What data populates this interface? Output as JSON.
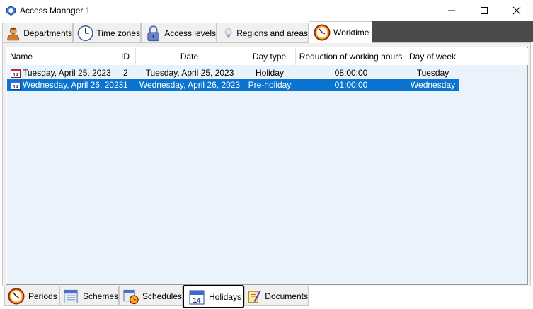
{
  "window": {
    "title": "Access Manager 1"
  },
  "top_tabs": [
    {
      "label": "Departments",
      "icon": "person-icon"
    },
    {
      "label": "Time zones",
      "icon": "clock-icon"
    },
    {
      "label": "Access levels",
      "icon": "lock-icon"
    },
    {
      "label": "Regions and areas",
      "icon": "lightbulb-icon"
    },
    {
      "label": "Worktime",
      "icon": "worktime-clock-icon",
      "active": true
    }
  ],
  "table": {
    "columns": [
      "Name",
      "ID",
      "Date",
      "Day type",
      "Reduction of working hours",
      "Day of week"
    ],
    "rows": [
      {
        "name": "Tuesday, April 25, 2023",
        "id": "2",
        "date": "Tuesday, April 25, 2023",
        "day_type": "Holiday",
        "reduction": "08:00:00",
        "day_of_week": "Tuesday",
        "selected": false
      },
      {
        "name": "Wednesday, April 26, 2023",
        "id": "1",
        "date": "Wednesday, April 26, 2023",
        "day_type": "Pre-holiday",
        "reduction": "01:00:00",
        "day_of_week": "Wednesday",
        "selected": true
      }
    ]
  },
  "bottom_tabs": [
    {
      "label": "Periods",
      "icon": "periods-clock-icon"
    },
    {
      "label": "Schemes",
      "icon": "schemes-calendar-icon"
    },
    {
      "label": "Schedules",
      "icon": "schedules-calendar-icon"
    },
    {
      "label": "Holidays",
      "icon": "holidays-calendar-icon",
      "active": true
    },
    {
      "label": "Documents",
      "icon": "documents-icon"
    }
  ],
  "colors": {
    "selection": "#0a74d0",
    "list_background": "#eaf3fc",
    "tab_strip_dark": "#4b4b4b"
  }
}
